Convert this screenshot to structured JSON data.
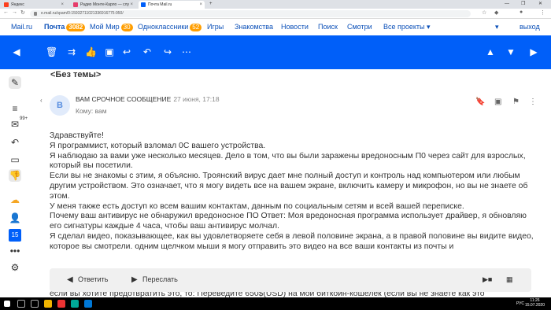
{
  "browser": {
    "tabs": [
      {
        "label": "Яндекс",
        "color": "#fc3f1d"
      },
      {
        "label": "Радио Монте-Карло — слу",
        "color": "#e63d6b"
      },
      {
        "label": "Почта Mail.ru",
        "color": "#005ff9"
      }
    ],
    "url": "e.mail.ru/spam/0:15932711021336916775:950/"
  },
  "portal": {
    "logo": "Mail.ru",
    "mail": "Почта",
    "mail_count": "3082",
    "moimir": "Мой Мир",
    "moimir_count": "30",
    "ok": "Одноклассники",
    "ok_count": "52",
    "games": "Игры",
    "dating": "Знакомства",
    "news": "Новости",
    "search": "Поиск",
    "watch": "Смотри",
    "projects": "Все проекты ▾",
    "logout": "выход"
  },
  "message": {
    "subject": "<Без темы>",
    "avatar_letter": "В",
    "sender": "ВАМ СРОЧНОЕ СООБЩЕНИЕ",
    "date": "27 июня, 17:18",
    "to": "Кому: вам",
    "body": [
      "Здравствуйте!",
      "Я программист, который взломал 0С вашего устройства.",
      "Я наблюдаю за вами уже несколько месяцев. Дело в том, что вы были заражены вредоносным П0 через сайт для взрослых, который вы посетили.",
      "Если вы не знакомы с этим, я объясню. Троянский вирус дает мне полный доступ и контроль над компьютером или любым другим устройством. Это означает, что я могу видеть все на вашем экране, включить камеру и микрофон, но вы не знаете об этом.",
      "У меня также есть доступ ко всем вашим контактам, данным по социальным сетям и всей вашей переписке.",
      "Почему ваш антивирус не обнаружил вредоносное ПО Ответ: Моя вредоносная программа использует драйвер, я обновляю его сигнатуры каждые 4 часа, чтобы ваш антивирус молчал.",
      "Я сделал видео, показывающее, как вы удовлетворяете себя в левой половине экрана, а в правой половине вы видите видео, которое вы смотрели. одним щелчком мыши я могу отправить это видео на все ваши контакты из почты и"
    ],
    "overflow_line": "если вы хотите предотвратить это, то: Переведите 650$(USD) на мой биткоин-кошелек (если вы не знаете как это"
  },
  "reply": {
    "reply_label": "Ответить",
    "forward_label": "Переслать"
  },
  "sidebar": {
    "badge": "99+",
    "calendar_day": "15"
  },
  "taskbar": {
    "lang": "РУС",
    "time": "11:26",
    "date": "15.07.2020"
  },
  "colors": {
    "toolbar": "#005ff9",
    "link": "#0a4fb8",
    "badge": "#ff9e00"
  }
}
